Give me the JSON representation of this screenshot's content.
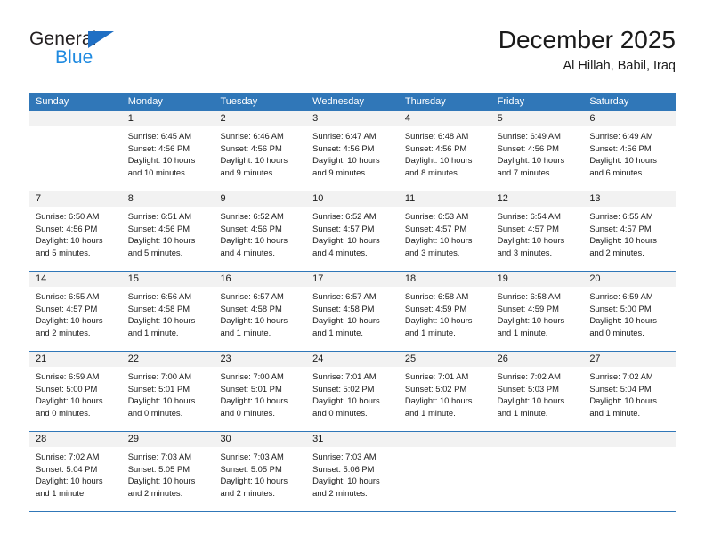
{
  "brand": {
    "name_part1": "General",
    "name_part2": "Blue",
    "triangle_color": "#1f6fc4",
    "blue_text_color": "#1f8ae0"
  },
  "header": {
    "title": "December 2025",
    "subtitle": "Al Hillah, Babil, Iraq"
  },
  "theme": {
    "header_row_color": "#3077B8",
    "day_band_color": "#f2f2f2",
    "grid_line_color": "#3077B8"
  },
  "weekdays": [
    "Sunday",
    "Monday",
    "Tuesday",
    "Wednesday",
    "Thursday",
    "Friday",
    "Saturday"
  ],
  "weeks": [
    [
      {
        "day": "",
        "sunrise": "",
        "sunset": "",
        "daylight1": "",
        "daylight2": ""
      },
      {
        "day": "1",
        "sunrise": "Sunrise: 6:45 AM",
        "sunset": "Sunset: 4:56 PM",
        "daylight1": "Daylight: 10 hours",
        "daylight2": "and 10 minutes."
      },
      {
        "day": "2",
        "sunrise": "Sunrise: 6:46 AM",
        "sunset": "Sunset: 4:56 PM",
        "daylight1": "Daylight: 10 hours",
        "daylight2": "and 9 minutes."
      },
      {
        "day": "3",
        "sunrise": "Sunrise: 6:47 AM",
        "sunset": "Sunset: 4:56 PM",
        "daylight1": "Daylight: 10 hours",
        "daylight2": "and 9 minutes."
      },
      {
        "day": "4",
        "sunrise": "Sunrise: 6:48 AM",
        "sunset": "Sunset: 4:56 PM",
        "daylight1": "Daylight: 10 hours",
        "daylight2": "and 8 minutes."
      },
      {
        "day": "5",
        "sunrise": "Sunrise: 6:49 AM",
        "sunset": "Sunset: 4:56 PM",
        "daylight1": "Daylight: 10 hours",
        "daylight2": "and 7 minutes."
      },
      {
        "day": "6",
        "sunrise": "Sunrise: 6:49 AM",
        "sunset": "Sunset: 4:56 PM",
        "daylight1": "Daylight: 10 hours",
        "daylight2": "and 6 minutes."
      }
    ],
    [
      {
        "day": "7",
        "sunrise": "Sunrise: 6:50 AM",
        "sunset": "Sunset: 4:56 PM",
        "daylight1": "Daylight: 10 hours",
        "daylight2": "and 5 minutes."
      },
      {
        "day": "8",
        "sunrise": "Sunrise: 6:51 AM",
        "sunset": "Sunset: 4:56 PM",
        "daylight1": "Daylight: 10 hours",
        "daylight2": "and 5 minutes."
      },
      {
        "day": "9",
        "sunrise": "Sunrise: 6:52 AM",
        "sunset": "Sunset: 4:56 PM",
        "daylight1": "Daylight: 10 hours",
        "daylight2": "and 4 minutes."
      },
      {
        "day": "10",
        "sunrise": "Sunrise: 6:52 AM",
        "sunset": "Sunset: 4:57 PM",
        "daylight1": "Daylight: 10 hours",
        "daylight2": "and 4 minutes."
      },
      {
        "day": "11",
        "sunrise": "Sunrise: 6:53 AM",
        "sunset": "Sunset: 4:57 PM",
        "daylight1": "Daylight: 10 hours",
        "daylight2": "and 3 minutes."
      },
      {
        "day": "12",
        "sunrise": "Sunrise: 6:54 AM",
        "sunset": "Sunset: 4:57 PM",
        "daylight1": "Daylight: 10 hours",
        "daylight2": "and 3 minutes."
      },
      {
        "day": "13",
        "sunrise": "Sunrise: 6:55 AM",
        "sunset": "Sunset: 4:57 PM",
        "daylight1": "Daylight: 10 hours",
        "daylight2": "and 2 minutes."
      }
    ],
    [
      {
        "day": "14",
        "sunrise": "Sunrise: 6:55 AM",
        "sunset": "Sunset: 4:57 PM",
        "daylight1": "Daylight: 10 hours",
        "daylight2": "and 2 minutes."
      },
      {
        "day": "15",
        "sunrise": "Sunrise: 6:56 AM",
        "sunset": "Sunset: 4:58 PM",
        "daylight1": "Daylight: 10 hours",
        "daylight2": "and 1 minute."
      },
      {
        "day": "16",
        "sunrise": "Sunrise: 6:57 AM",
        "sunset": "Sunset: 4:58 PM",
        "daylight1": "Daylight: 10 hours",
        "daylight2": "and 1 minute."
      },
      {
        "day": "17",
        "sunrise": "Sunrise: 6:57 AM",
        "sunset": "Sunset: 4:58 PM",
        "daylight1": "Daylight: 10 hours",
        "daylight2": "and 1 minute."
      },
      {
        "day": "18",
        "sunrise": "Sunrise: 6:58 AM",
        "sunset": "Sunset: 4:59 PM",
        "daylight1": "Daylight: 10 hours",
        "daylight2": "and 1 minute."
      },
      {
        "day": "19",
        "sunrise": "Sunrise: 6:58 AM",
        "sunset": "Sunset: 4:59 PM",
        "daylight1": "Daylight: 10 hours",
        "daylight2": "and 1 minute."
      },
      {
        "day": "20",
        "sunrise": "Sunrise: 6:59 AM",
        "sunset": "Sunset: 5:00 PM",
        "daylight1": "Daylight: 10 hours",
        "daylight2": "and 0 minutes."
      }
    ],
    [
      {
        "day": "21",
        "sunrise": "Sunrise: 6:59 AM",
        "sunset": "Sunset: 5:00 PM",
        "daylight1": "Daylight: 10 hours",
        "daylight2": "and 0 minutes."
      },
      {
        "day": "22",
        "sunrise": "Sunrise: 7:00 AM",
        "sunset": "Sunset: 5:01 PM",
        "daylight1": "Daylight: 10 hours",
        "daylight2": "and 0 minutes."
      },
      {
        "day": "23",
        "sunrise": "Sunrise: 7:00 AM",
        "sunset": "Sunset: 5:01 PM",
        "daylight1": "Daylight: 10 hours",
        "daylight2": "and 0 minutes."
      },
      {
        "day": "24",
        "sunrise": "Sunrise: 7:01 AM",
        "sunset": "Sunset: 5:02 PM",
        "daylight1": "Daylight: 10 hours",
        "daylight2": "and 0 minutes."
      },
      {
        "day": "25",
        "sunrise": "Sunrise: 7:01 AM",
        "sunset": "Sunset: 5:02 PM",
        "daylight1": "Daylight: 10 hours",
        "daylight2": "and 1 minute."
      },
      {
        "day": "26",
        "sunrise": "Sunrise: 7:02 AM",
        "sunset": "Sunset: 5:03 PM",
        "daylight1": "Daylight: 10 hours",
        "daylight2": "and 1 minute."
      },
      {
        "day": "27",
        "sunrise": "Sunrise: 7:02 AM",
        "sunset": "Sunset: 5:04 PM",
        "daylight1": "Daylight: 10 hours",
        "daylight2": "and 1 minute."
      }
    ],
    [
      {
        "day": "28",
        "sunrise": "Sunrise: 7:02 AM",
        "sunset": "Sunset: 5:04 PM",
        "daylight1": "Daylight: 10 hours",
        "daylight2": "and 1 minute."
      },
      {
        "day": "29",
        "sunrise": "Sunrise: 7:03 AM",
        "sunset": "Sunset: 5:05 PM",
        "daylight1": "Daylight: 10 hours",
        "daylight2": "and 2 minutes."
      },
      {
        "day": "30",
        "sunrise": "Sunrise: 7:03 AM",
        "sunset": "Sunset: 5:05 PM",
        "daylight1": "Daylight: 10 hours",
        "daylight2": "and 2 minutes."
      },
      {
        "day": "31",
        "sunrise": "Sunrise: 7:03 AM",
        "sunset": "Sunset: 5:06 PM",
        "daylight1": "Daylight: 10 hours",
        "daylight2": "and 2 minutes."
      },
      {
        "day": "",
        "sunrise": "",
        "sunset": "",
        "daylight1": "",
        "daylight2": ""
      },
      {
        "day": "",
        "sunrise": "",
        "sunset": "",
        "daylight1": "",
        "daylight2": ""
      },
      {
        "day": "",
        "sunrise": "",
        "sunset": "",
        "daylight1": "",
        "daylight2": ""
      }
    ]
  ]
}
